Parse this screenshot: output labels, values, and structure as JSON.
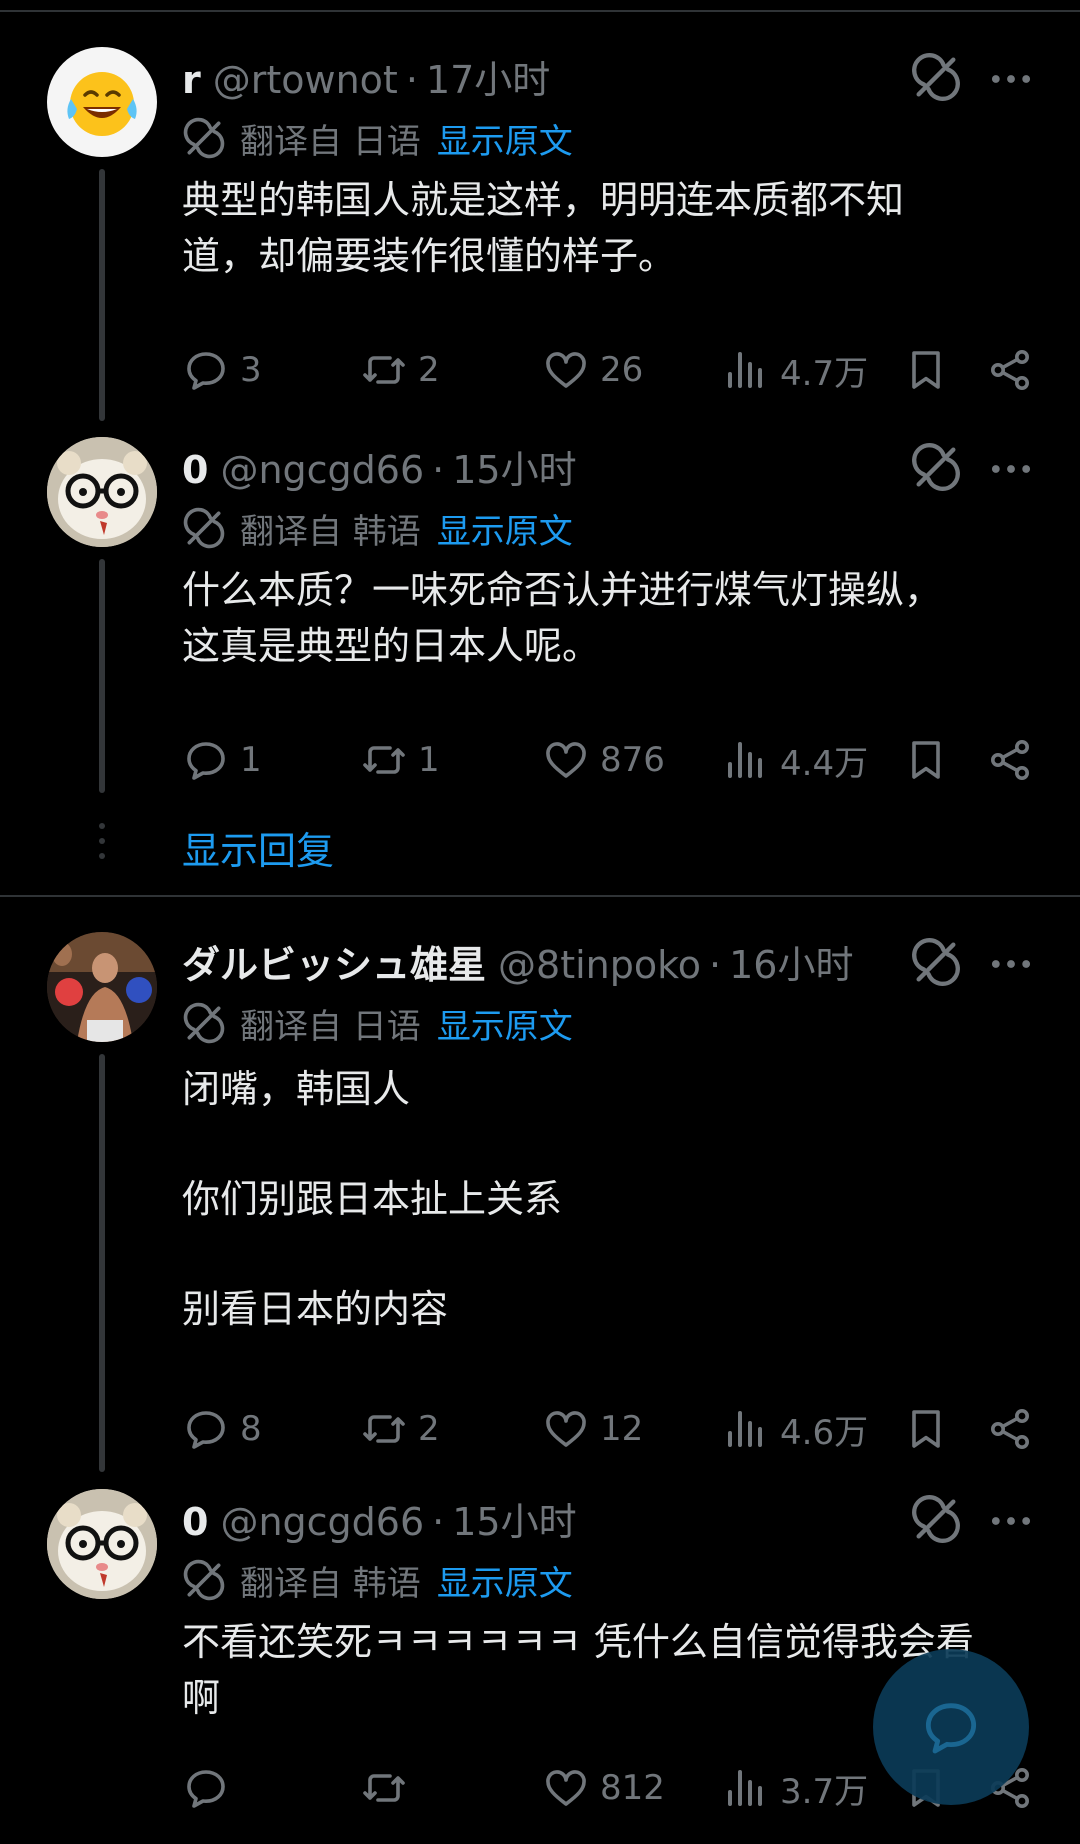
{
  "tweets": [
    {
      "name": "r",
      "handle": "@rtownot",
      "time": "17小时",
      "translated_from": "翻译自 日语",
      "show_original": "显示原文",
      "text": "典型的韩国人就是这样，明明连本质都不知\n道，却偏要装作很懂的样子。",
      "replies": "3",
      "retweets": "2",
      "likes": "26",
      "views": "4.7万"
    },
    {
      "name": "0",
      "handle": "@ngcgd66",
      "time": "15小时",
      "translated_from": "翻译自 韩语",
      "show_original": "显示原文",
      "text": "什么本质？一味死命否认并进行煤气灯操纵，\n这真是典型的日本人呢。",
      "replies": "1",
      "retweets": "1",
      "likes": "876",
      "views": "4.4万"
    },
    {
      "name": "ダルビッシュ雄星",
      "handle": "@8tinpoko",
      "time": "16小时",
      "translated_from": "翻译自 日语",
      "show_original": "显示原文",
      "text": "闭嘴，韩国人\n\n你们别跟日本扯上关系\n\n别看日本的内容",
      "replies": "8",
      "retweets": "2",
      "likes": "12",
      "views": "4.6万"
    },
    {
      "name": "0",
      "handle": "@ngcgd66",
      "time": "15小时",
      "translated_from": "翻译自 韩语",
      "show_original": "显示原文",
      "text": "不看还笑死ㅋㅋㅋㅋㅋㅋ 凭什么自信觉得我会看\n啊",
      "replies": "",
      "retweets": "",
      "likes": "812",
      "views": "3.7万"
    }
  ],
  "show_replies": "显示回复",
  "colors": {
    "background": "#000000",
    "text": "#e7e9ea",
    "muted": "#71767b",
    "link": "#1d9bf0",
    "divider": "#2f3336"
  },
  "icons": [
    "grok-icon",
    "more-icon",
    "translate-icon",
    "reply-icon",
    "retweet-icon",
    "like-icon",
    "views-icon",
    "bookmark-icon",
    "share-icon",
    "compose-reply-icon"
  ]
}
